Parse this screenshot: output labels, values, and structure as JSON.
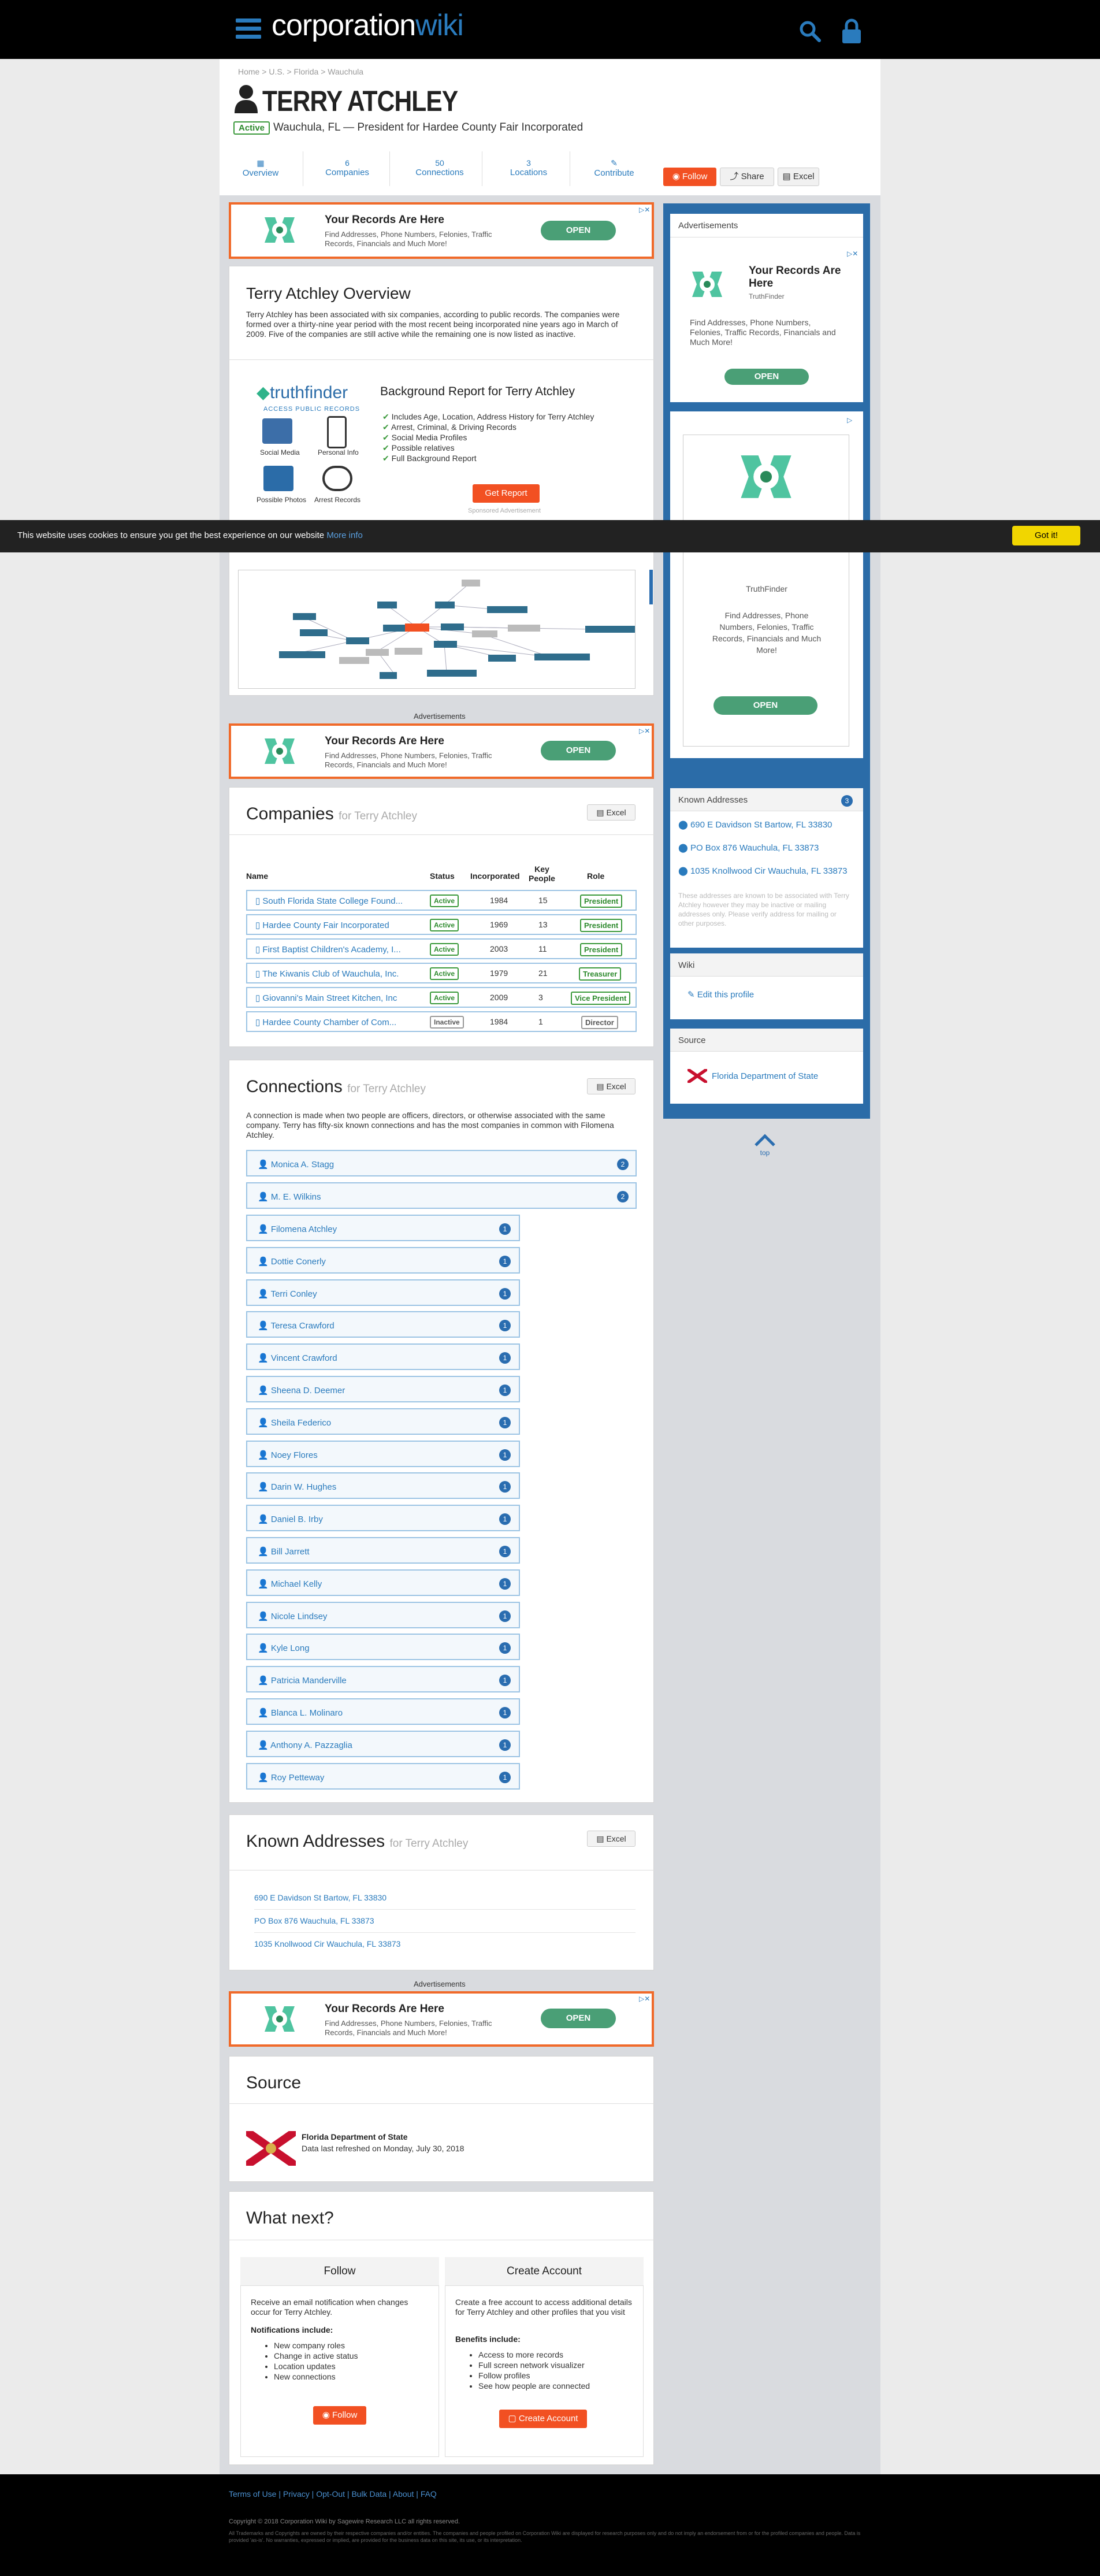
{
  "header": {
    "logo_main": "corporation",
    "logo_accent": "wiki"
  },
  "breadcrumb": [
    "Home",
    "U.S.",
    "Florida",
    "Wauchula"
  ],
  "person": {
    "name": "TERRY ATCHLEY",
    "status": "Active",
    "summary": "Wauchula, FL — President for Hardee County Fair Incorporated"
  },
  "stats": [
    {
      "num": "",
      "label": "Overview"
    },
    {
      "num": "6",
      "label": "Companies"
    },
    {
      "num": "50",
      "label": "Connections"
    },
    {
      "num": "3",
      "label": "Locations"
    },
    {
      "num": "",
      "label": "Contribute"
    }
  ],
  "actions": {
    "follow": "Follow",
    "share": "Share",
    "excel": "Excel"
  },
  "ad": {
    "title": "Your Records Are Here",
    "desc": "Find Addresses, Phone Numbers, Felonies, Traffic Records, Financials and Much More!",
    "open": "OPEN",
    "advertisements_label": "Advertisements",
    "brand": "TruthFinder"
  },
  "overview": {
    "title": "Terry Atchley Overview",
    "text": "Terry Atchley has been associated with six companies, according to public records. The companies were formed over a thirty-nine year period with the most recent being incorporated nine years ago in March of 2009. Five of the companies are still active while the remaining one is now listed as inactive."
  },
  "truthfinder": {
    "logo": "truthfinder",
    "sub": "ACCESS PUBLIC RECORDS",
    "icons": [
      "Social Media",
      "Personal Info",
      "Possible Photos",
      "Arrest Records"
    ],
    "title": "Background Report for Terry Atchley",
    "bullets": [
      "Includes Age, Location, Address History for Terry Atchley",
      "Arrest, Criminal, & Driving Records",
      "Social Media Profiles",
      "Possible relatives",
      "Full Background Report"
    ],
    "button": "Get Report",
    "sponsored": "Sponsored Advertisement"
  },
  "cookie": {
    "text": "This website uses cookies to ensure you get the best experience on our website",
    "more": "More info",
    "button": "Got it!"
  },
  "companies": {
    "title": "Companies",
    "for": "for Terry Atchley",
    "excel": "Excel",
    "headers": [
      "Name",
      "Status",
      "Incorporated",
      "Key People",
      "Role"
    ],
    "rows": [
      {
        "name": "South Florida State College Found...",
        "status": "Active",
        "year": "1984",
        "key": "15",
        "role": "President"
      },
      {
        "name": "Hardee County Fair Incorporated",
        "status": "Active",
        "year": "1969",
        "key": "13",
        "role": "President"
      },
      {
        "name": "First Baptist Children's Academy, I...",
        "status": "Active",
        "year": "2003",
        "key": "11",
        "role": "President"
      },
      {
        "name": "The Kiwanis Club of Wauchula, Inc.",
        "status": "Active",
        "year": "1979",
        "key": "21",
        "role": "Treasurer"
      },
      {
        "name": "Giovanni's Main Street Kitchen, Inc",
        "status": "Active",
        "year": "2009",
        "key": "3",
        "role": "Vice President"
      },
      {
        "name": "Hardee County Chamber of Com...",
        "status": "Inactive",
        "year": "1984",
        "key": "1",
        "role": "Director"
      }
    ]
  },
  "connections": {
    "title": "Connections",
    "for": "for Terry Atchley",
    "excel": "Excel",
    "text": "A connection is made when two people are officers, directors, or otherwise associated with the same company. Terry has fifty-six known connections and has the most companies in common with Filomena Atchley.",
    "wide": [
      {
        "name": "Monica A. Stagg",
        "count": "2"
      },
      {
        "name": "M. E. Wilkins",
        "count": "2"
      }
    ],
    "list": [
      {
        "name": "Filomena Atchley",
        "count": "1"
      },
      {
        "name": "Dottie Conerly",
        "count": "1"
      },
      {
        "name": "Terri Conley",
        "count": "1"
      },
      {
        "name": "Teresa Crawford",
        "count": "1"
      },
      {
        "name": "Vincent Crawford",
        "count": "1"
      },
      {
        "name": "Sheena D. Deemer",
        "count": "1"
      },
      {
        "name": "Sheila Federico",
        "count": "1"
      },
      {
        "name": "Noey Flores",
        "count": "1"
      },
      {
        "name": "Darin W. Hughes",
        "count": "1"
      },
      {
        "name": "Daniel B. Irby",
        "count": "1"
      },
      {
        "name": "Bill Jarrett",
        "count": "1"
      },
      {
        "name": "Michael Kelly",
        "count": "1"
      },
      {
        "name": "Nicole Lindsey",
        "count": "1"
      },
      {
        "name": "Kyle Long",
        "count": "1"
      },
      {
        "name": "Patricia Manderville",
        "count": "1"
      },
      {
        "name": "Blanca L. Molinaro",
        "count": "1"
      },
      {
        "name": "Anthony A. Pazzaglia",
        "count": "1"
      },
      {
        "name": "Roy Petteway",
        "count": "1"
      }
    ]
  },
  "addresses": {
    "title": "Known Addresses",
    "for": "for Terry Atchley",
    "excel": "Excel",
    "items": [
      "690 E Davidson St Bartow, FL 33830",
      "PO Box 876 Wauchula, FL 33873",
      "1035 Knollwood Cir Wauchula, FL 33873"
    ]
  },
  "source": {
    "title": "Source",
    "name": "Florida Department of State",
    "refreshed": "Data last refreshed on Monday, July 30, 2018"
  },
  "whatnext": {
    "title": "What next?",
    "follow": {
      "title": "Follow",
      "text": "Receive an email notification when changes occur for Terry Atchley.",
      "sub": "Notifications include:",
      "items": [
        "New company roles",
        "Change in active status",
        "Location updates",
        "New connections"
      ],
      "button": "Follow"
    },
    "account": {
      "title": "Create Account",
      "text": "Create a free account to access additional details for Terry Atchley and other profiles that you visit",
      "sub": "Benefits include:",
      "items": [
        "Access to more records",
        "Full screen network visualizer",
        "Follow profiles",
        "See how people are connected"
      ],
      "button": "Create Account"
    }
  },
  "sidebar": {
    "ads_label": "Advertisements",
    "ad_title": "Your Records Are Here",
    "ad_title_partial": "Your Records Are Here",
    "ad_desc": "Find Addresses, Phone Numbers, Felonies, Traffic Records, Financials and Much More!",
    "known_addresses": "Known Addresses",
    "addr_count": "3",
    "addr_note": "These addresses are known to be associated with Terry Atchley however they may be inactive or mailing addresses only. Please verify address for mailing or other purposes.",
    "wiki": "Wiki",
    "edit": "Edit this profile",
    "source": "Source",
    "source_name": "Florida Department of State",
    "top": "top"
  },
  "footer": {
    "links": [
      "Terms of Use",
      "Privacy",
      "Opt-Out",
      "Bulk Data",
      "About",
      "FAQ"
    ],
    "copyright": "Copyright © 2018 Corporation Wiki by Sagewire Research LLC all rights reserved.",
    "legal": "All Trademarks and Copyrights are owned by their respective companies and/or entities. The companies and people profiled on Corporation Wiki are displayed for research purposes only and do not imply an endorsement from or for the profiled companies and people. Data is provided 'as-is'. No warranties, expressed or implied, are provided for the business data on this site, its use, or its interpretation."
  },
  "network": {
    "center": "Terry Atchley"
  }
}
